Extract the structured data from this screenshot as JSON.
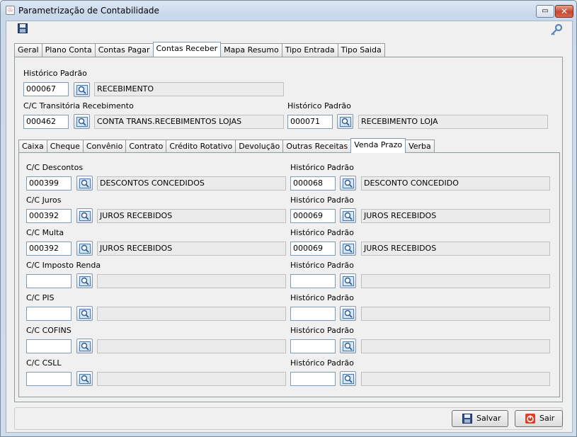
{
  "window": {
    "title": "Parametrização de Contabilidade",
    "restore_glyph": "▭",
    "close_glyph": "✕",
    "app_icon_glyph": "♨"
  },
  "main_tabs": [
    {
      "label": "Geral"
    },
    {
      "label": "Plano Conta"
    },
    {
      "label": "Contas Pagar"
    },
    {
      "label": "Contas Receber",
      "active": true
    },
    {
      "label": "Mapa Resumo"
    },
    {
      "label": "Tipo Entrada"
    },
    {
      "label": "Tipo Saida"
    }
  ],
  "top_section": {
    "historico_padrao": {
      "label": "Histórico Padrão",
      "code": "000067",
      "description": "RECEBIMENTO"
    },
    "cc_transitoria": {
      "label": "C/C Transitória Recebimento",
      "code": "000462",
      "description": "CONTA TRANS.RECEBIMENTOS LOJAS"
    },
    "historico_padrao_2": {
      "label": "Histórico Padrão",
      "code": "000071",
      "description": "RECEBIMENTO LOJA"
    }
  },
  "sub_tabs": [
    {
      "label": "Caixa"
    },
    {
      "label": "Cheque"
    },
    {
      "label": "Convênio"
    },
    {
      "label": "Contrato"
    },
    {
      "label": "Crédito Rotativo"
    },
    {
      "label": "Devolução"
    },
    {
      "label": "Outras Receitas"
    },
    {
      "label": "Venda Prazo",
      "active": true
    },
    {
      "label": "Verba"
    }
  ],
  "rows": [
    {
      "cc_label": "C/C Descontos",
      "cc_code": "000399",
      "cc_desc": "DESCONTOS CONCEDIDOS",
      "hist_label": "Histórico Padrão",
      "hist_code": "000068",
      "hist_desc": "DESCONTO CONCEDIDO"
    },
    {
      "cc_label": "C/C Juros",
      "cc_code": "000392",
      "cc_desc": "JUROS RECEBIDOS",
      "hist_label": "Histórico Padrão",
      "hist_code": "000069",
      "hist_desc": "JUROS RECEBIDOS"
    },
    {
      "cc_label": "C/C Multa",
      "cc_code": "000392",
      "cc_desc": "JUROS RECEBIDOS",
      "hist_label": "Histórico Padrão",
      "hist_code": "000069",
      "hist_desc": "JUROS RECEBIDOS"
    },
    {
      "cc_label": "C/C Imposto Renda",
      "cc_code": "",
      "cc_desc": "",
      "hist_label": "Histórico Padrão",
      "hist_code": "",
      "hist_desc": ""
    },
    {
      "cc_label": "C/C PIS",
      "cc_code": "",
      "cc_desc": "",
      "hist_label": "Histórico Padrão",
      "hist_code": "",
      "hist_desc": ""
    },
    {
      "cc_label": "C/C COFINS",
      "cc_code": "",
      "cc_desc": "",
      "hist_label": "Histórico Padrão",
      "hist_code": "",
      "hist_desc": ""
    },
    {
      "cc_label": "C/C CSLL",
      "cc_code": "",
      "cc_desc": "",
      "hist_label": "Histórico Padrão",
      "hist_code": "",
      "hist_desc": ""
    }
  ],
  "buttons": {
    "save": "Salvar",
    "exit": "Sair"
  },
  "icons": {
    "save": "floppy-disk-icon",
    "key": "key-icon",
    "search": "magnifier-icon",
    "exit": "power-icon"
  },
  "colors": {
    "titlebar": "#c9d9ec",
    "input_border": "#7f9db9",
    "readonly_bg": "#ebebeb",
    "exit_red": "#d9402a"
  }
}
